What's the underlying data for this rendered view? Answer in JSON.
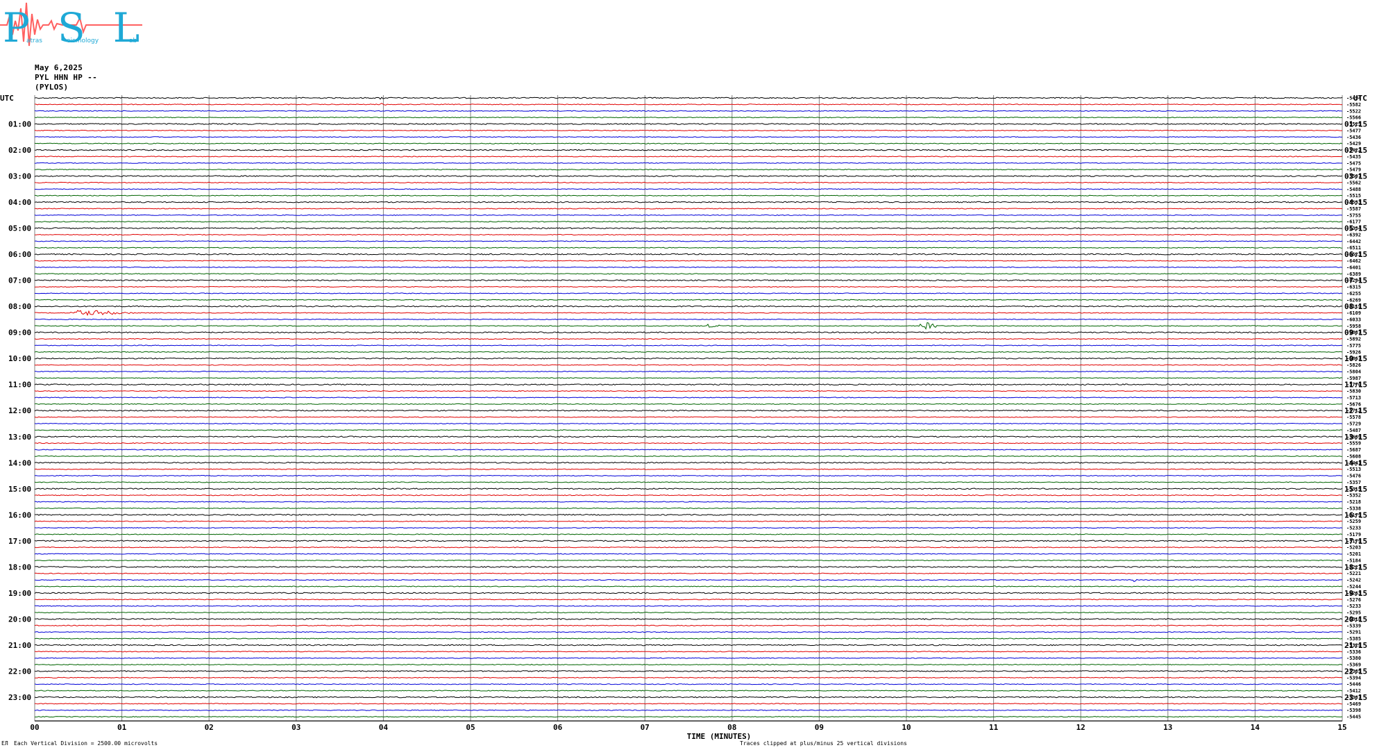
{
  "logo": {
    "text": "PSL",
    "subtext": [
      "atras",
      "eismology",
      "ab"
    ]
  },
  "header": {
    "date": "May 6,2025",
    "station": "PYL HHN HP --",
    "location": "(PYLOS)"
  },
  "footer": {
    "scale_note": "Each Vertical Division = 2500.00 microvolts",
    "corner_mark": "ЕЛ",
    "clip_note": "Traces clipped at plus/minus 25 vertical divisions"
  },
  "colors": {
    "black": "#000000",
    "red": "#e00000",
    "blue": "#0000d8",
    "green": "#006400",
    "grid": "#808080"
  },
  "chart_data": {
    "type": "line",
    "title": "",
    "xlabel": "TIME (MINUTES)",
    "ylabel": "UTC",
    "left_axis_label": "UTC",
    "right_axis_label": "UTC",
    "x_ticks": [
      "00",
      "01",
      "02",
      "03",
      "04",
      "05",
      "06",
      "07",
      "08",
      "09",
      "10",
      "11",
      "12",
      "13",
      "14",
      "15"
    ],
    "xlim": [
      0,
      15
    ],
    "left_hour_labels": [
      "01:00",
      "02:00",
      "03:00",
      "04:00",
      "05:00",
      "06:00",
      "07:00",
      "08:00",
      "09:00",
      "10:00",
      "11:00",
      "12:00",
      "13:00",
      "14:00",
      "15:00",
      "16:00",
      "17:00",
      "18:00",
      "19:00",
      "20:00",
      "21:00",
      "22:00",
      "23:00"
    ],
    "right_hour_labels": [
      "01:15",
      "02:15",
      "03:15",
      "04:15",
      "05:15",
      "06:15",
      "07:15",
      "08:15",
      "09:15",
      "10:15",
      "11:15",
      "12:15",
      "13:15",
      "14:15",
      "15:15",
      "16:15",
      "17:15",
      "18:15",
      "19:15",
      "20:15",
      "21:15",
      "22:15",
      "23:15"
    ],
    "trace_color_cycle": [
      "black",
      "red",
      "blue",
      "green"
    ],
    "trace_count": 96,
    "trace_offsets": [
      "-5494",
      "-5582",
      "-5522",
      "-5566",
      "-5525",
      "-5477",
      "-5436",
      "-5429",
      "-5422",
      "-5435",
      "-5475",
      "-5479",
      "-5507",
      "-5562",
      "-5488",
      "-5515",
      "-5533",
      "-5587",
      "-5755",
      "-6177",
      "-6334",
      "-6392",
      "-6442",
      "-6511",
      "-6523",
      "-6462",
      "-6401",
      "-6389",
      "-6294",
      "-6315",
      "-6255",
      "-6269",
      "-6119",
      "-6109",
      "-6033",
      "-5958",
      "-5887",
      "-5892",
      "-5775",
      "-5926",
      "-5867",
      "-5826",
      "-5804",
      "-5987",
      "-5770",
      "-5830",
      "-5713",
      "-5676",
      "-5712",
      "-5578",
      "-5729",
      "-5487",
      "-5689",
      "-5559",
      "-5687",
      "-5608",
      "-5441",
      "-5513",
      "-5476",
      "-5357",
      "-5315",
      "-5352",
      "-5218",
      "-5338",
      "-5179",
      "-5259",
      "-5233",
      "-5179",
      "-5179",
      "-5203",
      "-5201",
      "-5184",
      "-5227",
      "-5221",
      "-5242",
      "-5244",
      "-5263",
      "-5276",
      "-5233",
      "-5295",
      "-5318",
      "-5339",
      "-5291",
      "-5385",
      "-5329",
      "-5336",
      "-5380",
      "-5369",
      "-5385",
      "-5394",
      "-5446",
      "-5412",
      "-5387",
      "-5469",
      "-5398",
      "-5445"
    ],
    "events": [
      {
        "trace": 33,
        "minute": 0.4,
        "span_minutes": 0.8,
        "amplitude": 5,
        "color": "blue"
      },
      {
        "trace": 35,
        "minute": 10.15,
        "span_minutes": 0.25,
        "amplitude": 8,
        "color": "green"
      },
      {
        "trace": 35,
        "minute": 7.7,
        "span_minutes": 0.2,
        "amplitude": 3,
        "color": "green"
      },
      {
        "trace": 0,
        "minute": 3.95,
        "span_minutes": 0.1,
        "amplitude": 2,
        "color": "black"
      },
      {
        "trace": 1,
        "minute": 3.95,
        "span_minutes": 0.1,
        "amplitude": 3,
        "color": "red"
      },
      {
        "trace": 74,
        "minute": 12.6,
        "span_minutes": 0.05,
        "amplitude": 4,
        "color": "blue"
      },
      {
        "trace": 75,
        "minute": 11.0,
        "span_minutes": 0.05,
        "amplitude": 3,
        "color": "black"
      }
    ]
  }
}
